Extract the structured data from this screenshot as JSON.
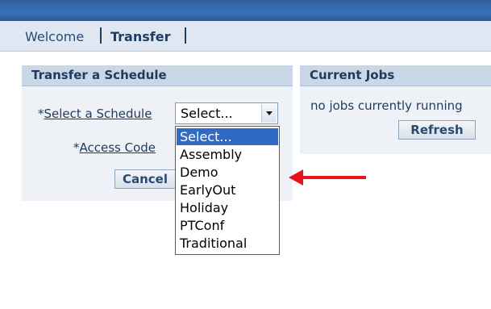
{
  "nav": {
    "welcome_label": "Welcome",
    "transfer_label": "Transfer"
  },
  "transfer_panel": {
    "title": "Transfer a Schedule",
    "schedule_field": {
      "required_mark": "*",
      "label": "Select a Schedule",
      "value": "Select..."
    },
    "access_code_field": {
      "required_mark": "*",
      "label": "Access Code"
    },
    "cancel_label": "Cancel"
  },
  "schedule_options": [
    "Select...",
    "Assembly",
    "Demo",
    "EarlyOut",
    "Holiday",
    "PTConf",
    "Traditional"
  ],
  "selected_option_index": 0,
  "jobs_panel": {
    "title": "Current Jobs",
    "status_text": "no jobs currently running",
    "refresh_label": "Refresh"
  },
  "colors": {
    "header_blue": "#3a73b8",
    "panel_bg": "#eef2f7",
    "panel_header_bg": "#c9d7e6",
    "selection_blue": "#316ac5",
    "annotation_arrow": "#e8141c"
  }
}
